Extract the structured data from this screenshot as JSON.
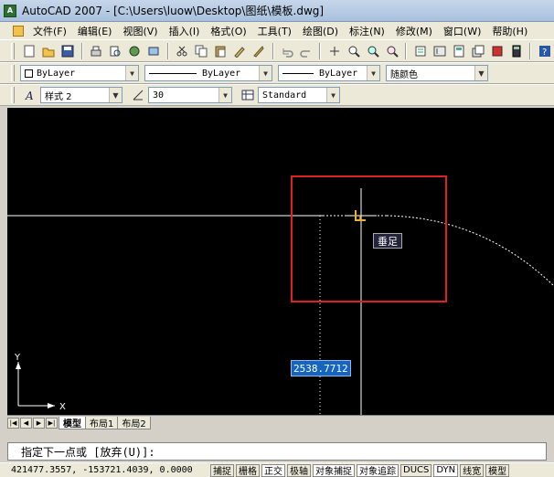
{
  "window": {
    "title": "AutoCAD 2007 - [C:\\Users\\luow\\Desktop\\图纸\\模板.dwg]",
    "app_icon_label": "A"
  },
  "menu": [
    "文件(F)",
    "编辑(E)",
    "视图(V)",
    "插入(I)",
    "格式(O)",
    "工具(T)",
    "绘图(D)",
    "标注(N)",
    "修改(M)",
    "窗口(W)",
    "帮助(H)"
  ],
  "layers_toolbar": {
    "layer": "ByLayer",
    "linetype": "ByLayer",
    "lineweight": "ByLayer",
    "color": "随颜色"
  },
  "styles_toolbar": {
    "text_style": "样式 2",
    "dim_value": "30",
    "table_style": "Standard"
  },
  "canvas": {
    "snap_tooltip": "垂足",
    "dynamic_input_value": "2538.7712",
    "ucs_x": "X",
    "ucs_y": "Y",
    "highlight_color": "#e02020",
    "background": "#000000"
  },
  "tabs": [
    "模型",
    "布局1",
    "布局2"
  ],
  "command_line": {
    "prompt": "指定下一点或 [放弃(U)]:"
  },
  "status": {
    "coords": "421477.3557, -153721.4039, 0.0000",
    "buttons": [
      "捕捉",
      "栅格",
      "正交",
      "极轴",
      "对象捕捉",
      "对象追踪",
      "DUCS",
      "DYN",
      "线宽",
      "模型"
    ]
  }
}
